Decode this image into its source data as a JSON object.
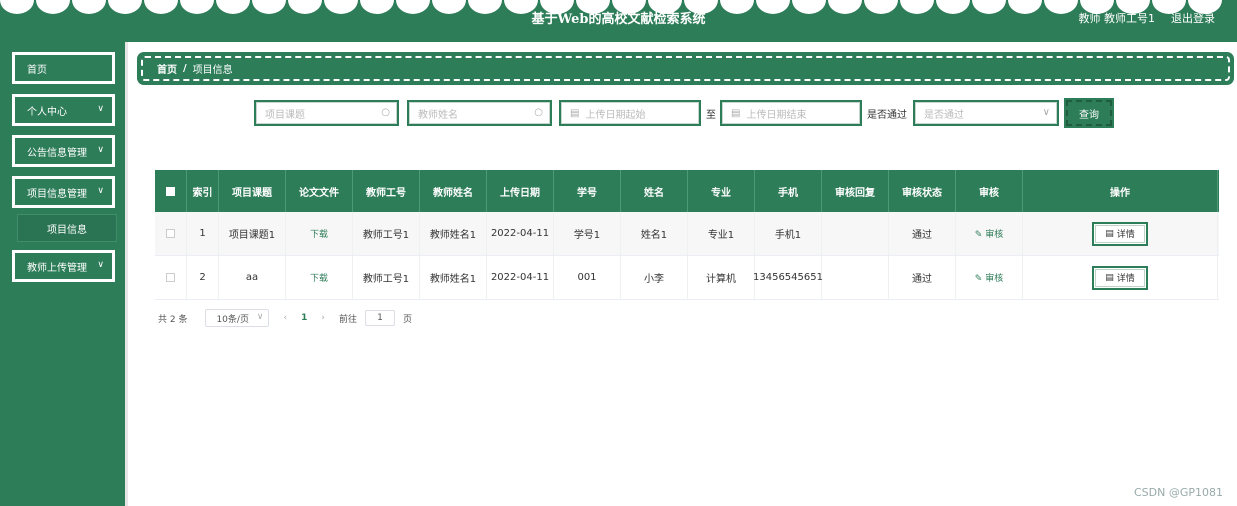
{
  "header": {
    "title": "基于Web的高校文献检索系统",
    "user_role": "教师",
    "user_id": "教师工号1",
    "logout": "退出登录"
  },
  "sidebar": {
    "items": [
      {
        "label": "首页",
        "expandable": false
      },
      {
        "label": "个人中心",
        "expandable": true
      },
      {
        "label": "公告信息管理",
        "expandable": true
      },
      {
        "label": "项目信息管理",
        "expandable": true
      },
      {
        "label": "教师上传管理",
        "expandable": true
      }
    ],
    "subitem": "项目信息"
  },
  "breadcrumb": {
    "home": "首页",
    "separator": "/",
    "current": "项目信息"
  },
  "search": {
    "project_placeholder": "项目课题",
    "teacher_placeholder": "教师姓名",
    "date_start_placeholder": "上传日期起始",
    "to_label": "至",
    "date_end_placeholder": "上传日期结束",
    "pass_label": "是否通过",
    "pass_placeholder": "是否通过",
    "query_button": "查询"
  },
  "table": {
    "headers": [
      "索引",
      "项目课题",
      "论文文件",
      "教师工号",
      "教师姓名",
      "上传日期",
      "学号",
      "姓名",
      "专业",
      "手机",
      "审核回复",
      "审核状态",
      "审核",
      "操作"
    ],
    "rows": [
      {
        "index": "1",
        "project": "项目课题1",
        "file": "下载",
        "teacher_id": "教师工号1",
        "teacher_name": "教师姓名1",
        "date": "2022-04-11",
        "student_id": "学号1",
        "name": "姓名1",
        "major": "专业1",
        "phone": "手机1",
        "reply": "",
        "status": "通过",
        "review": "审核",
        "action": "详情"
      },
      {
        "index": "2",
        "project": "aa",
        "file": "下载",
        "teacher_id": "教师工号1",
        "teacher_name": "教师姓名1",
        "date": "2022-04-11",
        "student_id": "001",
        "name": "小李",
        "major": "计算机",
        "phone": "13456545651",
        "reply": "",
        "status": "通过",
        "review": "审核",
        "action": "详情"
      }
    ]
  },
  "pagination": {
    "total_prefix": "共 2 条",
    "page_size": "10条/页",
    "current_page": "1",
    "goto_label": "前往",
    "goto_value": "1",
    "page_suffix": "页"
  },
  "watermark": "CSDN @GP1081",
  "colors": {
    "primary": "#2e7d59"
  }
}
